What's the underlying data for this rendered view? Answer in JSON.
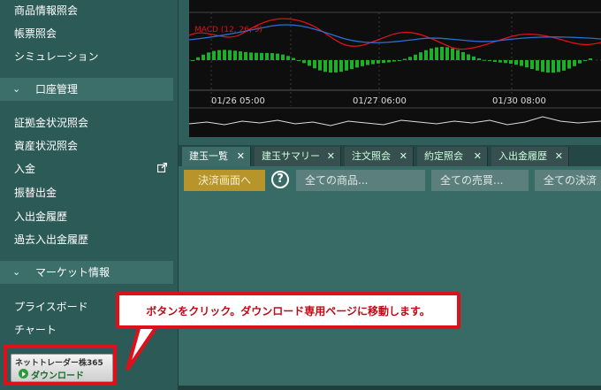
{
  "sidebar": {
    "top_items": [
      "商品情報照会",
      "帳票照会",
      "シミュレーション"
    ],
    "section_account": "口座管理",
    "account_items": [
      "証拠金状況照会",
      "資産状況照会",
      "入金",
      "振替出金",
      "入出金履歴",
      "過去入出金履歴"
    ],
    "section_market": "マーケット情報",
    "market_items": [
      "プライスボード",
      "チャート"
    ],
    "download_button": {
      "line1": "ネットトレーダー株365",
      "line2": "ダウンロード"
    }
  },
  "chart": {
    "indicator_label": "MACD (12, 26, 9)",
    "x_labels": [
      "01/26 05:00",
      "01/27 06:00",
      "01/30 08:00"
    ]
  },
  "tabs": [
    {
      "label": "建玉一覧",
      "active": true
    },
    {
      "label": "建玉サマリー",
      "active": false
    },
    {
      "label": "注文照会",
      "active": false
    },
    {
      "label": "約定照会",
      "active": false
    },
    {
      "label": "入出金履歴",
      "active": false
    }
  ],
  "tab_close": "✕",
  "filters": {
    "settle_button": "決済画面へ",
    "help": "?",
    "product": "全ての商品...",
    "side": "全ての売買...",
    "settlement": "全ての決済"
  },
  "callout": {
    "text": "ボタンをクリック。ダウンロード専用ページに移動します。"
  },
  "colors": {
    "highlight_red": "#e0101a",
    "settle_gold": "#b7952a",
    "macd_red": "#e0101a",
    "signal_blue": "#2a6fd6",
    "hist_green": "#1fae2a"
  }
}
